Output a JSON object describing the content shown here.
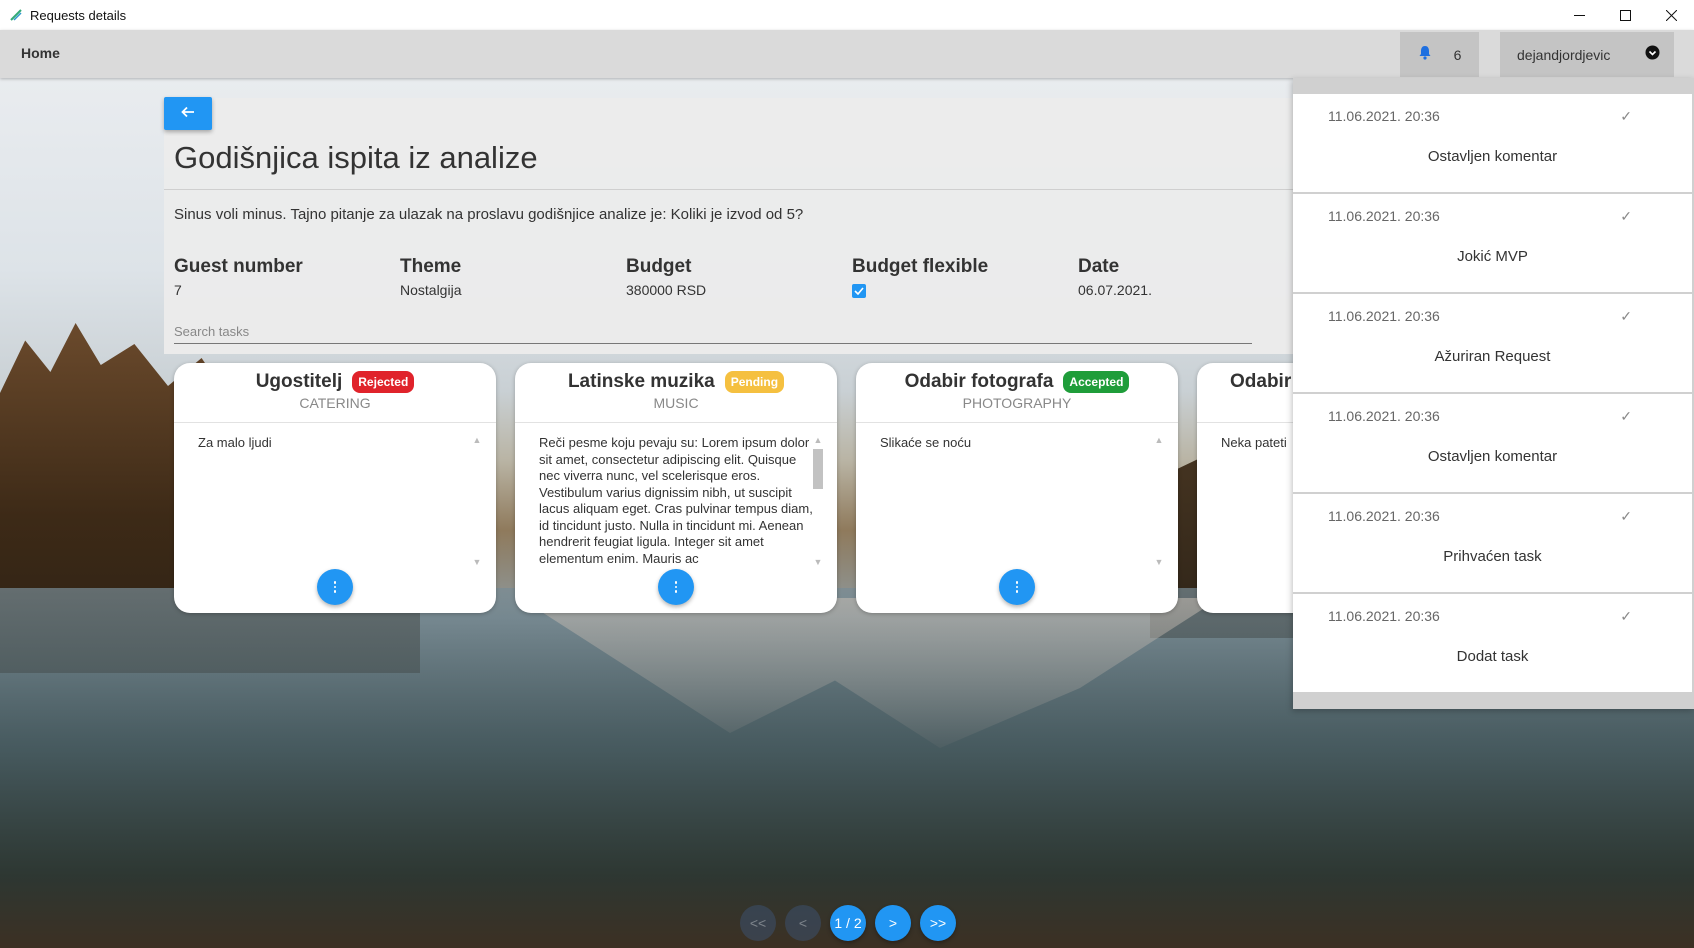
{
  "window": {
    "title": "Requests details"
  },
  "navbar": {
    "home_label": "Home",
    "notification_count": "6",
    "username": "dejandjordjevic"
  },
  "request": {
    "title": "Godišnjica ispita iz analize",
    "description": "Sinus voli minus. Tajno pitanje za ulazak na proslavu godišnjice analize je: Koliki je izvod od 5?",
    "fields": [
      {
        "label": "Guest number",
        "value": "7"
      },
      {
        "label": "Theme",
        "value": "Nostalgija"
      },
      {
        "label": "Budget",
        "value": "380000 RSD"
      },
      {
        "label": "Budget flexible",
        "checked": true
      },
      {
        "label": "Date",
        "value": "06.07.2021."
      }
    ],
    "search_placeholder": "Search tasks"
  },
  "tasks": [
    {
      "name": "Ugostitelj",
      "status": "Rejected",
      "category": "CATERING",
      "description": "Za malo ljudi"
    },
    {
      "name": "Latinske muzika",
      "status": "Pending",
      "category": "MUSIC",
      "description": "Reči pesme koju pevaju su: Lorem ipsum dolor sit amet, consectetur adipiscing elit. Quisque nec viverra nunc, vel scelerisque eros. Vestibulum varius dignissim nibh, ut suscipit lacus aliquam eget. Cras pulvinar tempus diam, id tincidunt justo. Nulla in tincidunt mi. Aenean hendrerit feugiat ligula. Integer sit amet elementum enim. Mauris ac"
    },
    {
      "name": "Odabir fotografa",
      "status": "Accepted",
      "category": "PHOTOGRAPHY",
      "description": "Slikaće se noću"
    },
    {
      "name": "Odabir",
      "status": "",
      "category": "",
      "description": "Neka pateti"
    }
  ],
  "pagination": {
    "first": "<<",
    "prev": "<",
    "current": "1 / 2",
    "next": ">",
    "last": ">>"
  },
  "notifications": [
    {
      "time": "11.06.2021. 20:36",
      "text": "Ostavljen komentar"
    },
    {
      "time": "11.06.2021. 20:36",
      "text": "Jokić MVP"
    },
    {
      "time": "11.06.2021. 20:36",
      "text": "Ažuriran Request"
    },
    {
      "time": "11.06.2021. 20:36",
      "text": "Ostavljen komentar"
    },
    {
      "time": "11.06.2021. 20:36",
      "text": "Prihvaćen task"
    },
    {
      "time": "11.06.2021. 20:36",
      "text": "Dodat task"
    }
  ],
  "colors": {
    "primary": "#2196f3",
    "rejected": "#e0232b",
    "pending": "#f5c040",
    "accepted": "#1f9d3a"
  },
  "icons": [
    "app-icon",
    "bell-icon",
    "chevron-down-circle-icon",
    "arrow-left-icon",
    "more-vert-icon",
    "check-icon",
    "scroll-up-icon",
    "scroll-down-icon"
  ]
}
